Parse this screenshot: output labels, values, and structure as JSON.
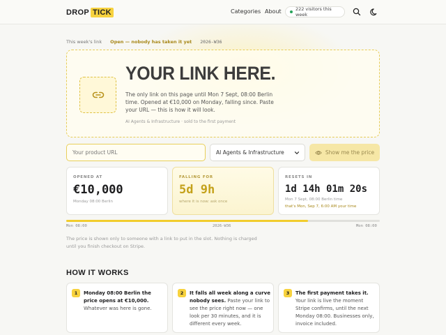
{
  "brand": {
    "part1": "DROP",
    "part2": "TICK"
  },
  "nav": {
    "categories": "Categories",
    "about": "About",
    "visitors": "222 visitors this week"
  },
  "week": {
    "label": "This week's link",
    "status": "Open — nobody has taken it yet",
    "code": "2026-W36"
  },
  "slot": {
    "title": "YOUR LINK HERE.",
    "description": "The only link on this page until Mon 7 Sept, 08:00 Berlin time. Opened at €10,000 on Monday, falling since. Paste your URL — this is how it will look.",
    "sub": "AI Agents & Infrastructure · sold to the first payment"
  },
  "form": {
    "url_placeholder": "Your product URL",
    "category": "AI Agents & Infrastructure",
    "price_button": "Show me the price"
  },
  "stats": {
    "opened": {
      "label": "OPENED AT",
      "value": "€10,000",
      "sub": "Monday 08:00 Berlin"
    },
    "falling": {
      "label": "FALLING FOR",
      "value": "5d 9h",
      "sub": "where it is now: ask once"
    },
    "resets": {
      "label": "RESETS IN",
      "value": "1d 14h 01m 20s",
      "sub": "Mon 7 Sept, 08:00 Berlin time",
      "local": "that's Mon, Sep 7, 6:00 AM your time"
    }
  },
  "progress": {
    "fraction": 0.77,
    "start": "Mon 08:00",
    "mid": "2026-W36",
    "end": "Mon 08:00"
  },
  "note": "The price is shown only to someone with a link to put in the slot. Nothing is charged until you finish checkout on Stripe.",
  "how": {
    "title": "HOW IT WORKS",
    "steps": [
      {
        "num": "1",
        "bold": "Monday 08:00 Berlin the price opens at €10,000.",
        "text": " Whatever was here is gone."
      },
      {
        "num": "2",
        "bold": "It falls all week along a curve nobody sees.",
        "text": " Paste your link to see the price right now — one look per 30 minutes, and it is different every week."
      },
      {
        "num": "3",
        "bold": "The first payment takes it.",
        "text": " Your link is live the moment Stripe confirms, until the next Monday 08:00. Businesses only, invoice included."
      }
    ]
  },
  "colors": {
    "accent": "#f7d23e",
    "accent_text": "#a8881a",
    "online": "#27a35a"
  }
}
